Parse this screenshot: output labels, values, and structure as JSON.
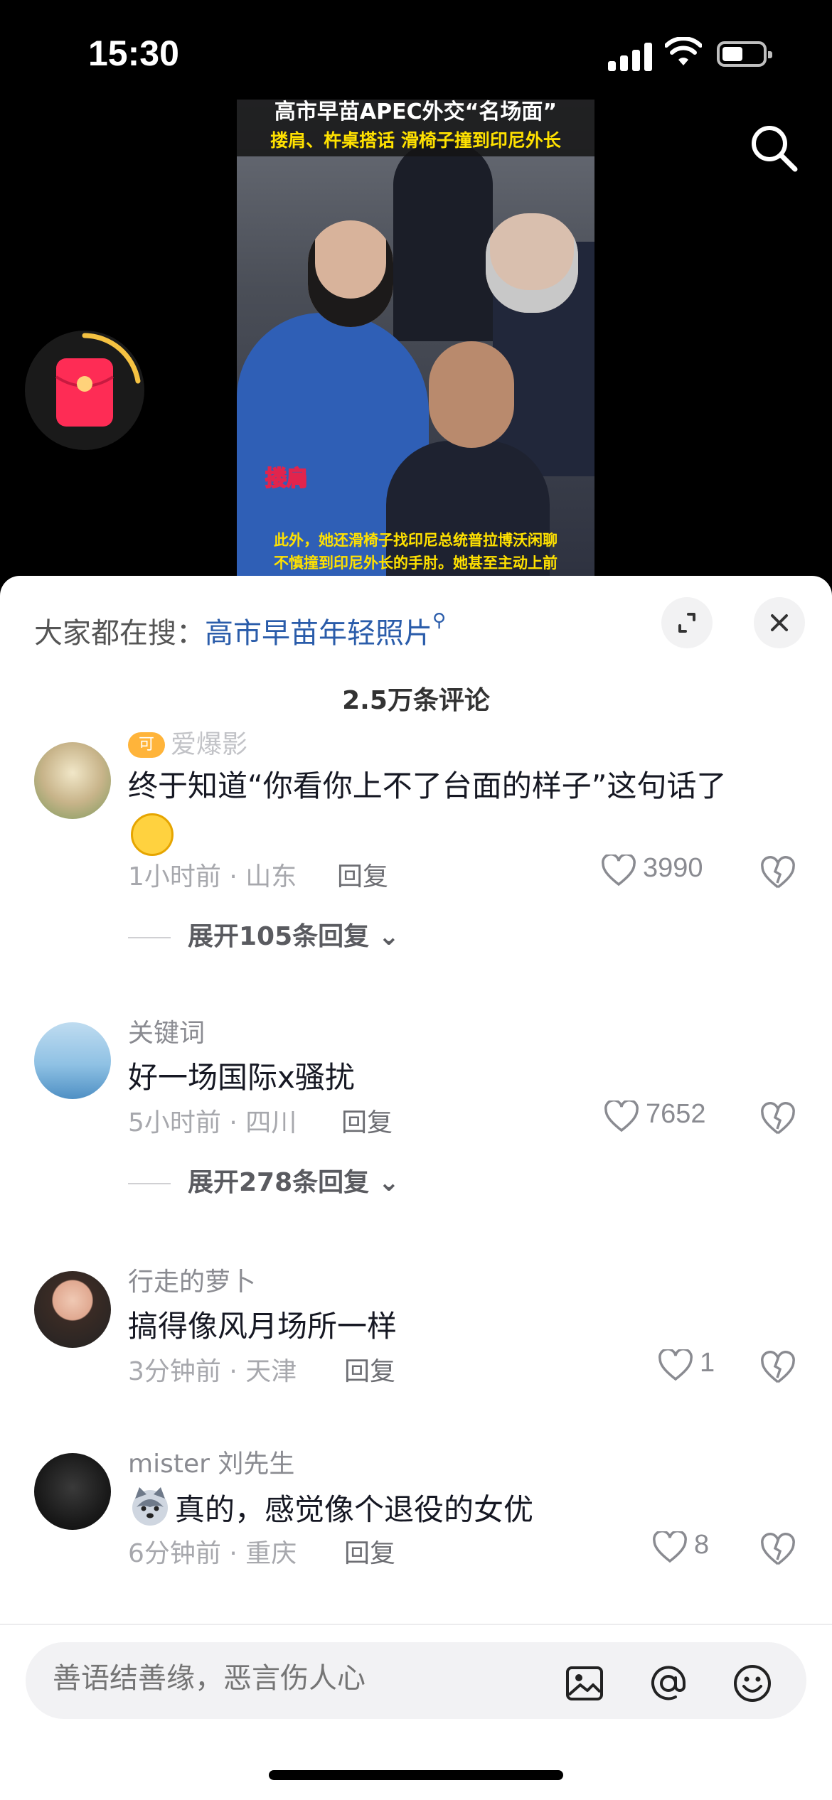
{
  "status_bar": {
    "time": "15:30"
  },
  "video": {
    "title_line1": "高市早苗APEC外交“名场面”",
    "title_line2": "搂肩、杵桌搭话 滑椅子撞到印尼外长",
    "tag": "搂肩",
    "caption_line1": "此外，她还滑椅子找印尼总统普拉博沃闲聊",
    "caption_line2": "不慎撞到印尼外长的手肘。她甚至主动上前"
  },
  "sheet": {
    "hot_search_prefix": "大家都在搜：",
    "hot_search_term": "高市早苗年轻照片",
    "comment_count": "2.5万条评论"
  },
  "comments": [
    {
      "username": "爱爆影",
      "text": "终于知道“你看你上不了台面的样子”这句话了",
      "time": "1小时前",
      "location": "山东",
      "reply_label": "回复",
      "likes": "3990",
      "expand": "展开105条回复"
    },
    {
      "username": "关键词",
      "text": "好一场国际x骚扰",
      "time": "5小时前",
      "location": "四川",
      "reply_label": "回复",
      "likes": "7652",
      "expand": "展开278条回复"
    },
    {
      "username": "行走的萝卜",
      "text": "搞得像风月场所一样",
      "time": "3分钟前",
      "location": "天津",
      "reply_label": "回复",
      "likes": "1"
    },
    {
      "username": "mister 刘先生",
      "text": "真的，感觉像个退役的女优",
      "time": "6分钟前",
      "location": "重庆",
      "reply_label": "回复",
      "likes": "8"
    }
  ],
  "input_bar": {
    "placeholder": "善语结善缘，恶言伤人心"
  },
  "colors": {
    "accent_link": "#2a5caa",
    "red_packet": "#fe2c55",
    "text_primary": "#161823",
    "text_secondary": "#8a8b91"
  }
}
